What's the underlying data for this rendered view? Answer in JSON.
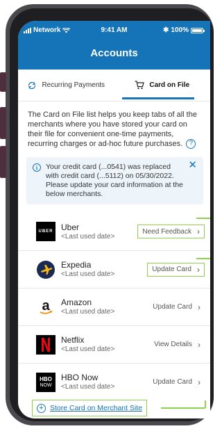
{
  "status_bar": {
    "carrier": "Network",
    "time": "9:41 AM",
    "battery": "100%"
  },
  "header": {
    "title": "Accounts"
  },
  "tabs": [
    {
      "label": "Recurring Payments",
      "icon": "refresh-icon",
      "active": false
    },
    {
      "label": "Card on File",
      "icon": "cart-icon",
      "active": true
    }
  ],
  "intro": {
    "text": "The Card on File list helps you keep tabs of all the merchants where you have stored your card on their file for convenient one-time payments, recurring charges or ad-hoc future purchases."
  },
  "notice": {
    "text": "Your credit card (...0541) was replaced with credit card (...5112) on 05/30/2022. Please update your card information at the below merchants."
  },
  "merchants": [
    {
      "name": "Uber",
      "date": "<Last used date>",
      "action": "Need Feedback",
      "highlighted": true
    },
    {
      "name": "Expedia",
      "date": "<Last used date>",
      "action": "Update Card",
      "highlighted": true
    },
    {
      "name": "Amazon",
      "date": "<Last used date>",
      "action": "Update Card",
      "highlighted": false
    },
    {
      "name": "Netflix",
      "date": "<Last used date>",
      "action": "View Details",
      "highlighted": false
    },
    {
      "name": "HBO Now",
      "date": "<Last used date>",
      "action": "Update Card",
      "highlighted": false
    }
  ],
  "logos": {
    "uber": "UBER",
    "hbo_top": "HBO",
    "hbo_bottom": "NOW"
  },
  "store_link": {
    "label": "Store Card on Merchant Site"
  },
  "colors": {
    "primary": "#1573b8",
    "highlight": "#8fd14f",
    "notice_bg": "#edf5fb"
  }
}
